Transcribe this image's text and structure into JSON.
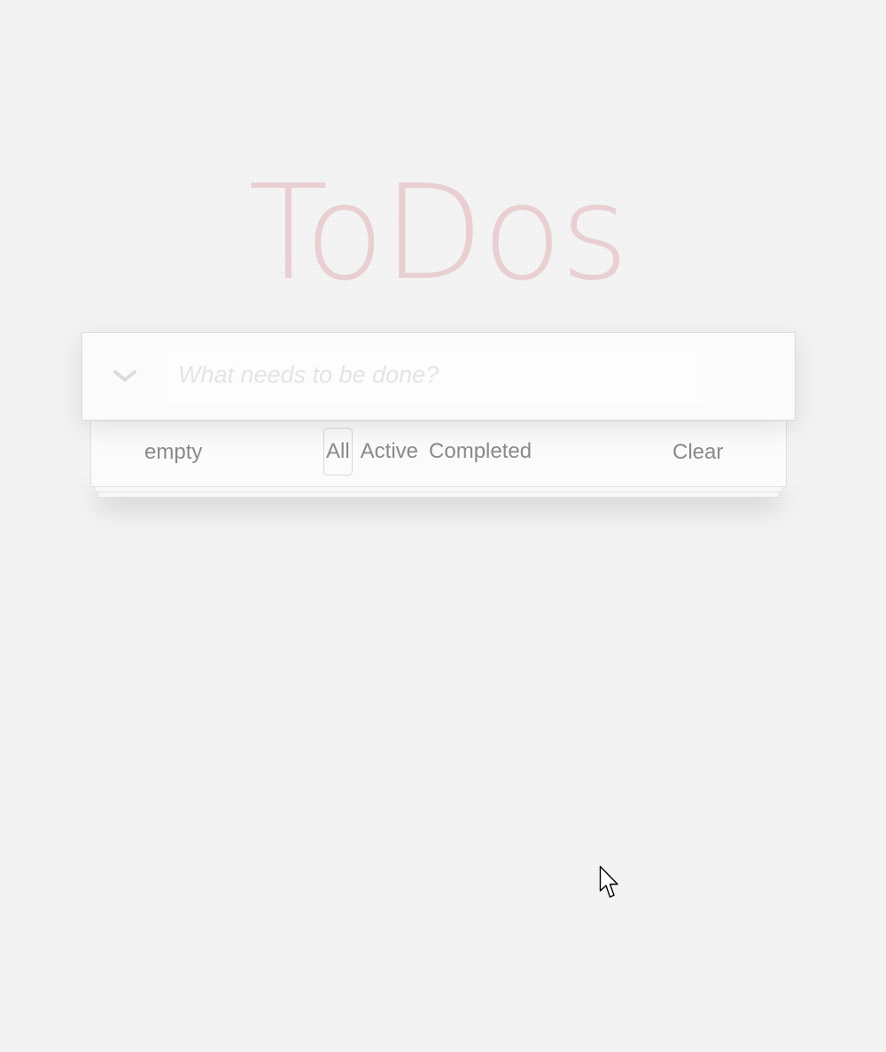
{
  "header": {
    "title": "ToDos"
  },
  "new_todo": {
    "placeholder": "What needs to be done?",
    "value": ""
  },
  "toggle_all": {
    "icon": "chevron-down-icon"
  },
  "footer": {
    "count_text": "empty",
    "filters": [
      {
        "label": "All",
        "selected": true
      },
      {
        "label": "Active",
        "selected": false
      },
      {
        "label": "Completed",
        "selected": false
      }
    ],
    "clear_label": "Clear"
  },
  "colors": {
    "title": "#eacfd2",
    "footer_text": "#8a8a8a",
    "placeholder": "#e4e4e4",
    "background": "#f4f4f4"
  },
  "cursor": {
    "icon": "mouse-pointer-icon"
  }
}
